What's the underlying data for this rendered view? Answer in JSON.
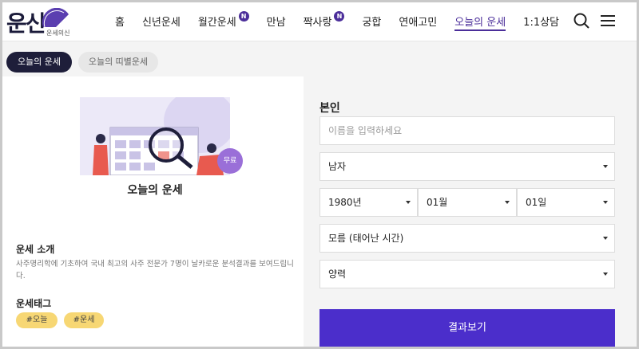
{
  "logo": {
    "text": "운신",
    "sub": "운세의신"
  },
  "nav": {
    "items": [
      {
        "label": "홈",
        "badge": ""
      },
      {
        "label": "신년운세",
        "badge": ""
      },
      {
        "label": "월간운세",
        "badge": "N"
      },
      {
        "label": "만남",
        "badge": ""
      },
      {
        "label": "짝사랑",
        "badge": "N"
      },
      {
        "label": "궁합",
        "badge": ""
      },
      {
        "label": "연애고민",
        "badge": ""
      },
      {
        "label": "오늘의 운세",
        "badge": "",
        "active": true
      },
      {
        "label": "1:1상담",
        "badge": ""
      }
    ],
    "icons": [
      "search-icon",
      "menu-icon"
    ]
  },
  "subtabs": {
    "active": "오늘의 운세",
    "inactive": "오늘의 띠별운세"
  },
  "card": {
    "free_badge": "무료",
    "title": "오늘의 운세",
    "intro_title": "운세 소개",
    "intro_text": "사주명리학에 기초하여 국내 최고의 사주 전문가 7명이 날카로운 분석결과를 보여드립니다.",
    "tags_title": "운세태그",
    "tags": [
      "#오늘",
      "#운세"
    ]
  },
  "form": {
    "title": "본인",
    "name_placeholder": "이름을 입력하세요",
    "gender": "남자",
    "year": "1980년",
    "month": "01월",
    "day": "01일",
    "birth_time": "모름 (태어난 시간)",
    "calendar": "양력",
    "submit": "결과보기"
  },
  "colors": {
    "accent": "#4b2ecb",
    "brand_dark": "#1e1e3a",
    "tag": "#f7d774",
    "badge": "#4b2e9a"
  }
}
